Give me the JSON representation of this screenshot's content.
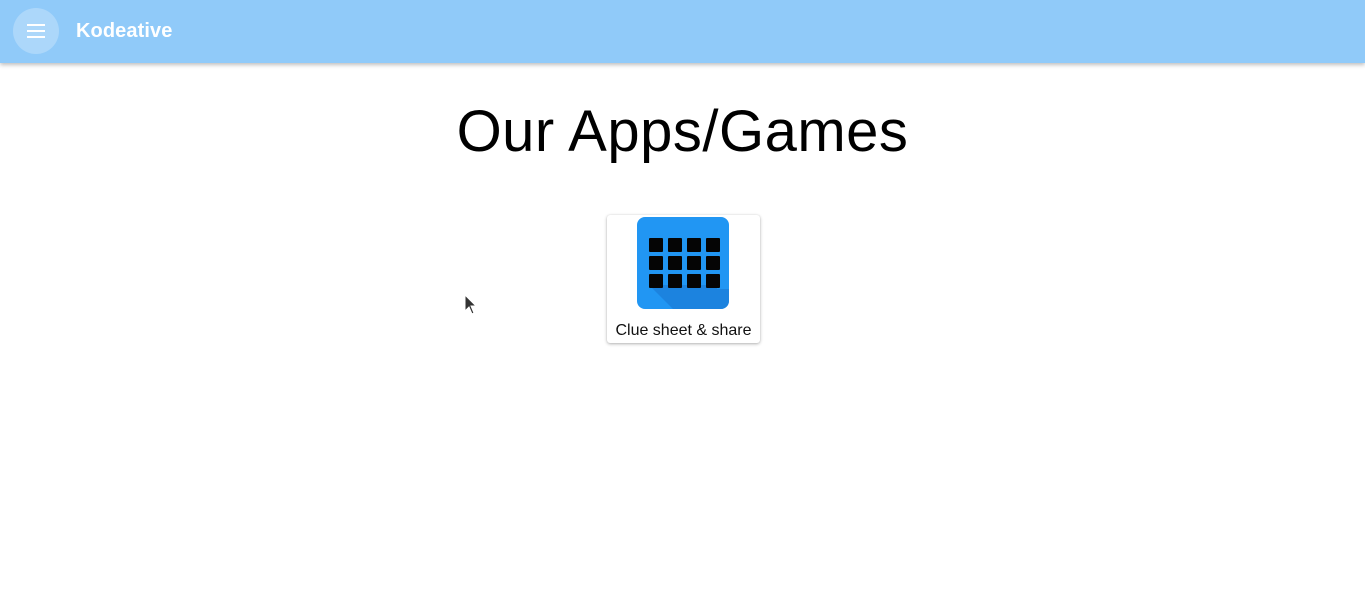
{
  "header": {
    "menu_icon": "menu-icon",
    "title": "Kodeative",
    "background_color": "#90caf9"
  },
  "main": {
    "heading": "Our Apps/Games",
    "apps": [
      {
        "label": "Clue sheet & share",
        "icon": "grid-icon",
        "icon_color": "#2196f3"
      }
    ]
  }
}
